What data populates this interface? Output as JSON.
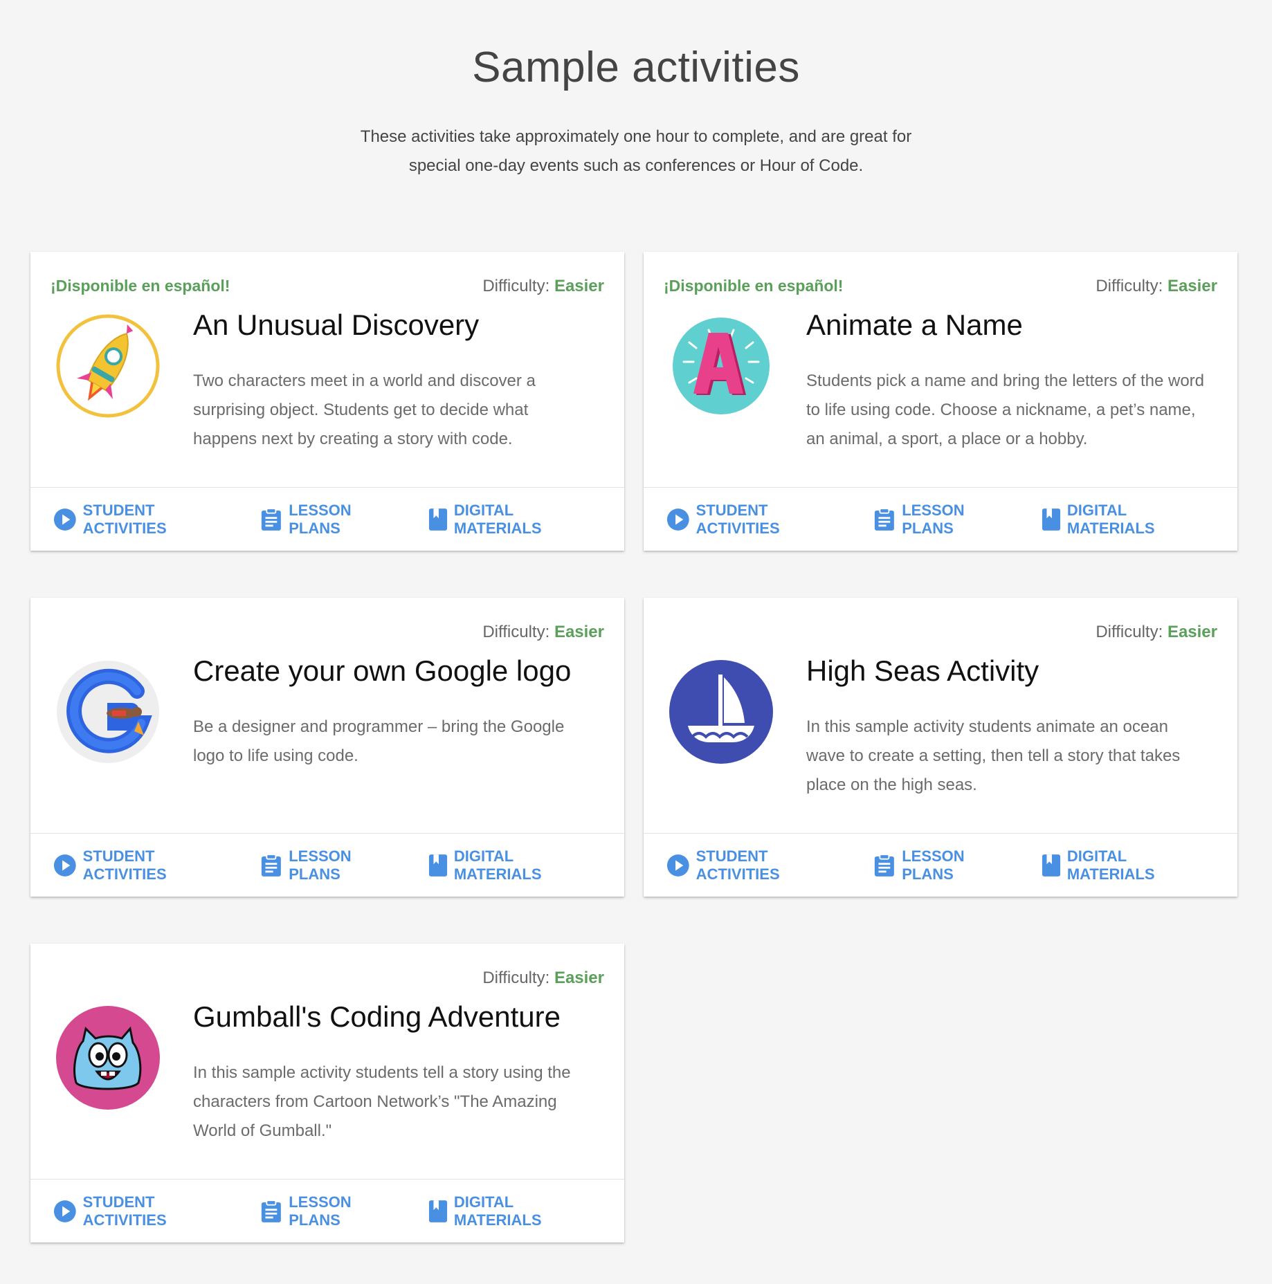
{
  "header": {
    "title": "Sample activities",
    "subtitle": "These activities take approximately one hour to complete, and are great for special one-day events such as conferences or Hour of Code."
  },
  "colors": {
    "accent_blue": "#4a90e2",
    "difficulty_green": "#5aa05a"
  },
  "difficulty_label": "Difficulty:",
  "actions": {
    "student_activities": "STUDENT ACTIVITIES",
    "lesson_plans": "LESSON PLANS",
    "digital_materials": "DIGITAL MATERIALS"
  },
  "cards": [
    {
      "tag": "¡Disponible en español!",
      "difficulty": "Easier",
      "title": "An Unusual Discovery",
      "description": "Two characters meet in a world and discover a surprising object. Students get to decide what happens next by creating a story with code.",
      "icon": "rocket-icon"
    },
    {
      "tag": "¡Disponible en español!",
      "difficulty": "Easier",
      "title": "Animate a Name",
      "description": "Students pick a name and bring the letters of the word to life using code. Choose a nickname, a pet’s name, an animal, a sport, a place or a hobby.",
      "icon": "letter-a-icon"
    },
    {
      "tag": "",
      "difficulty": "Easier",
      "title": "Create your own Google logo",
      "description": "Be a designer and programmer – bring the Google logo to life using code.",
      "icon": "google-g-icon"
    },
    {
      "tag": "",
      "difficulty": "Easier",
      "title": "High Seas Activity",
      "description": "In this sample activity students animate an ocean wave to create a setting, then tell a story that takes place on the high seas.",
      "icon": "sailboat-icon"
    },
    {
      "tag": "",
      "difficulty": "Easier",
      "title": "Gumball's Coding Adventure",
      "description": "In this sample activity students tell a story using the characters from Cartoon Network’s \"The Amazing World of Gumball.\"",
      "icon": "gumball-icon"
    }
  ]
}
